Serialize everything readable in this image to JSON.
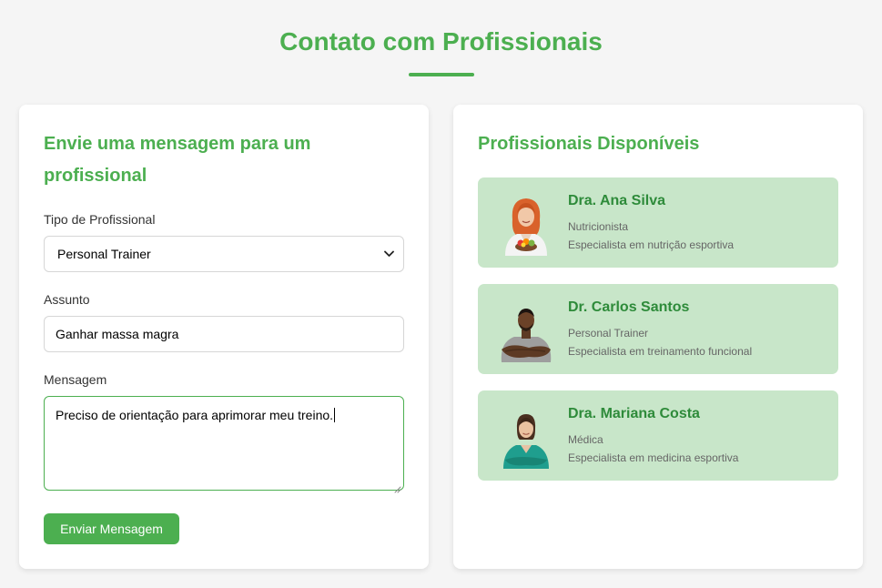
{
  "page": {
    "title": "Contato com Profissionais",
    "accent_color": "#4caf50"
  },
  "form": {
    "heading": "Envie uma mensagem para um profissional",
    "type_label": "Tipo de Profissional",
    "type_selected": "Personal Trainer",
    "subject_label": "Assunto",
    "subject_value": "Ganhar massa magra",
    "message_label": "Mensagem",
    "message_value": "Preciso de orientação para aprimorar meu treino.",
    "submit_label": "Enviar Mensagem"
  },
  "professionals": {
    "heading": "Profissionais Disponíveis",
    "card_color": "#c8e6c9",
    "items": [
      {
        "name": "Dra. Ana Silva",
        "role": "Nutricionista",
        "specialty": "Especialista em nutrição esportiva",
        "avatar": "avatar-female-redhead-holding-fruit-bowl"
      },
      {
        "name": "Dr. Carlos Santos",
        "role": "Personal Trainer",
        "specialty": "Especialista em treinamento funcional",
        "avatar": "avatar-male-athlete-arms-crossed"
      },
      {
        "name": "Dra. Mariana Costa",
        "role": "Médica",
        "specialty": "Especialista em medicina esportiva",
        "avatar": "avatar-female-doctor-teal-scrubs"
      }
    ]
  }
}
